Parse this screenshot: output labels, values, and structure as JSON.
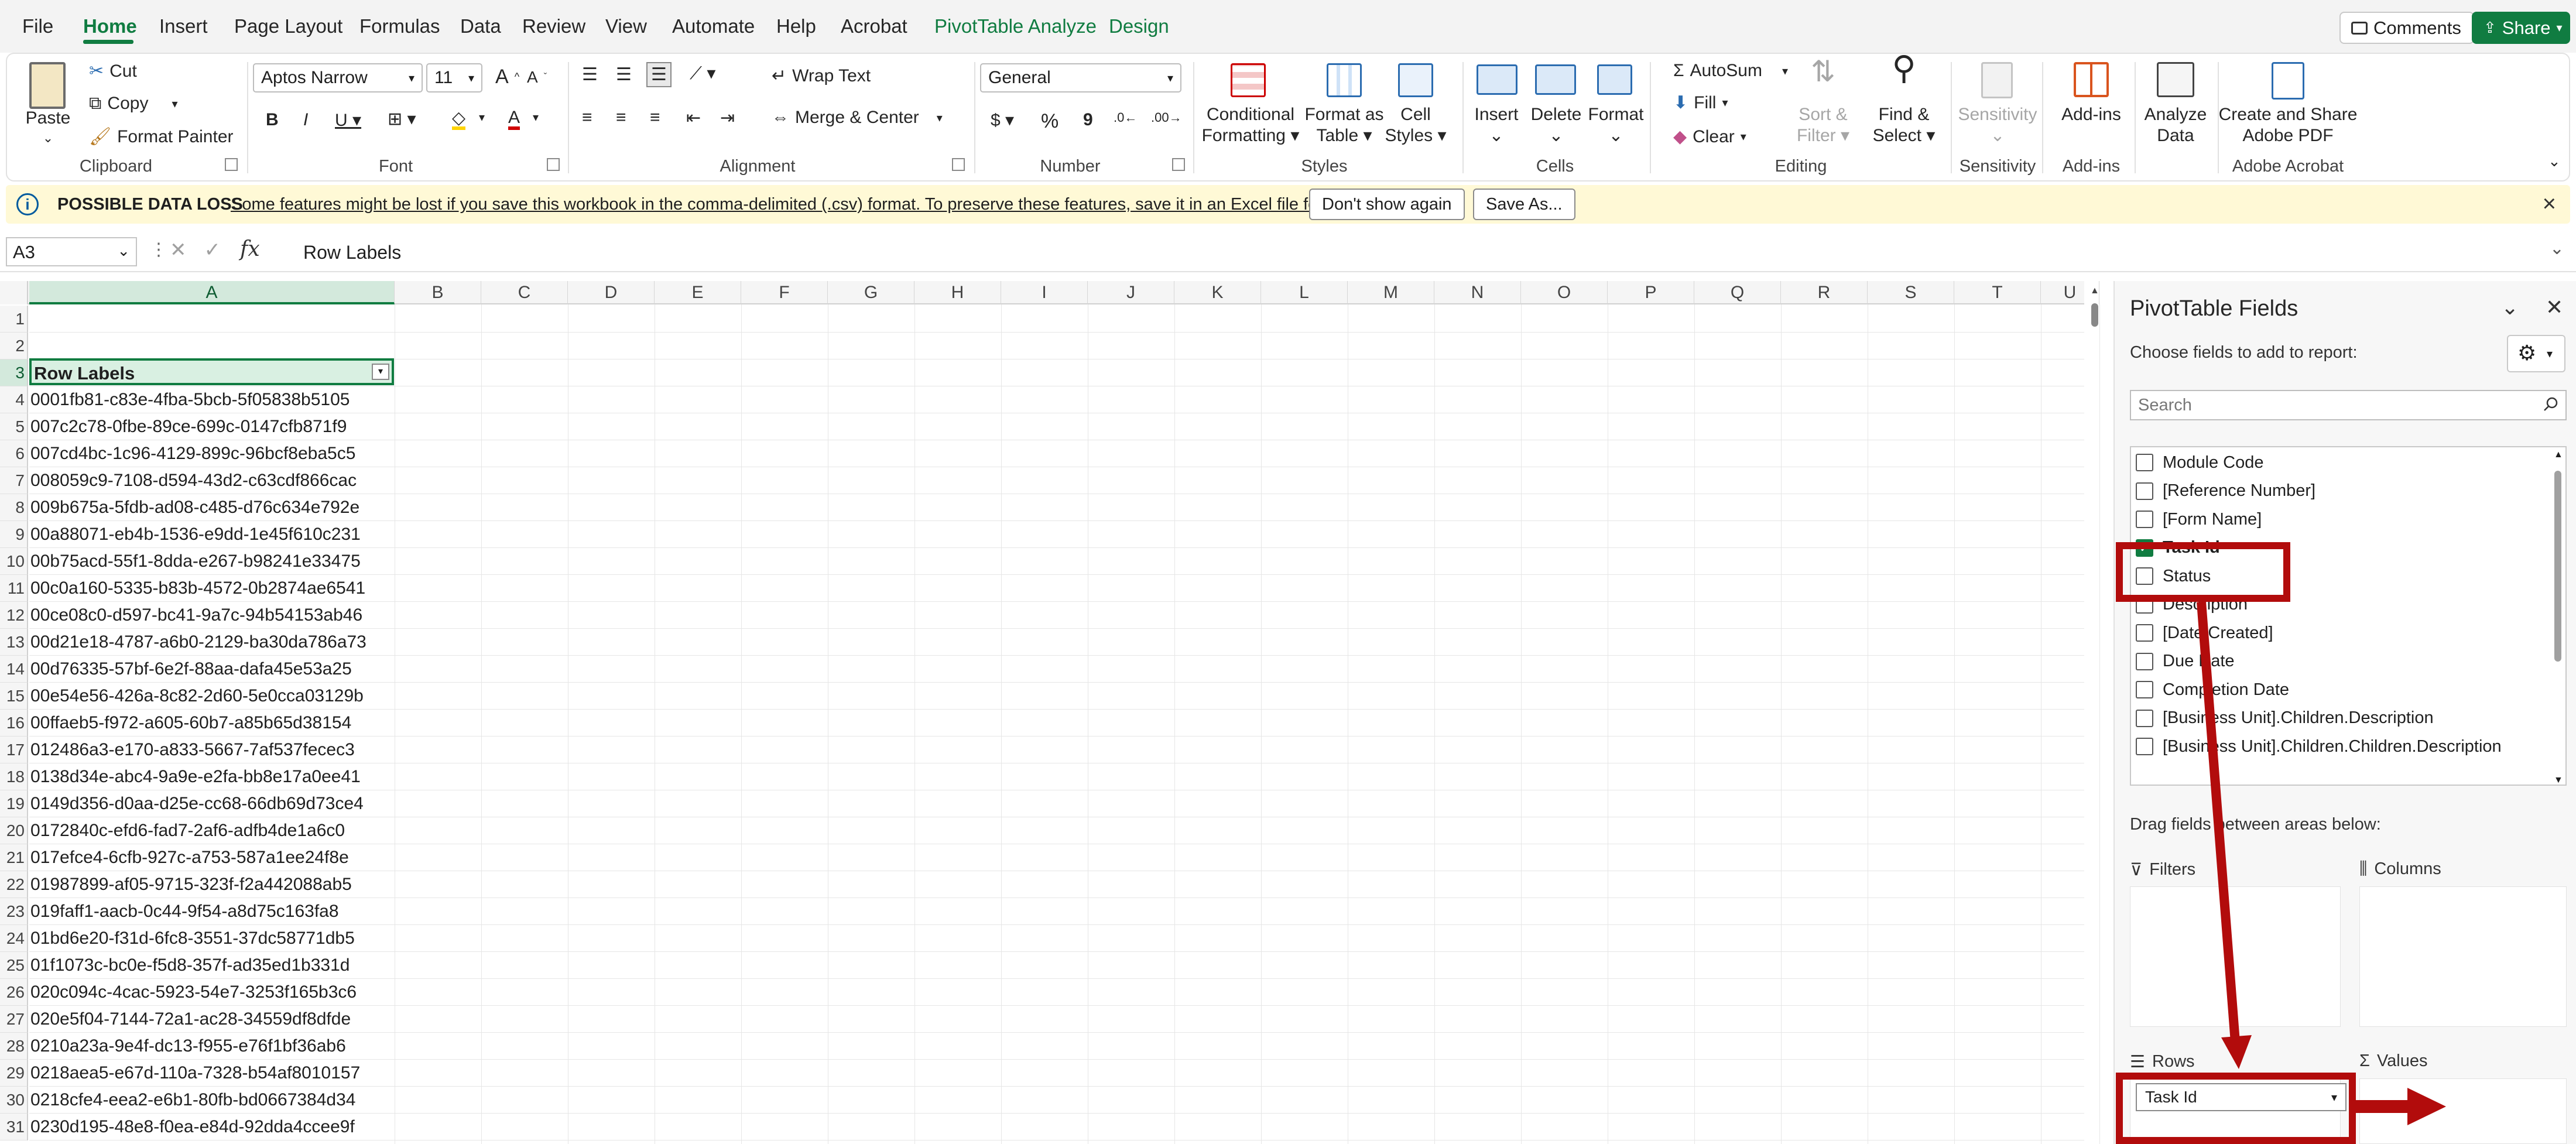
{
  "menu": {
    "tabs": [
      "File",
      "Home",
      "Insert",
      "Page Layout",
      "Formulas",
      "Data",
      "Review",
      "View",
      "Automate",
      "Help",
      "Acrobat",
      "PivotTable Analyze",
      "Design"
    ],
    "comments_label": "Comments",
    "share_label": "Share"
  },
  "ribbon": {
    "clipboard": {
      "paste": "Paste",
      "cut": "Cut",
      "copy": "Copy",
      "format_painter": "Format Painter",
      "label": "Clipboard"
    },
    "font": {
      "name": "Aptos Narrow",
      "size": "11",
      "label": "Font"
    },
    "alignment": {
      "wrap_text": "Wrap Text",
      "merge_center": "Merge & Center",
      "label": "Alignment"
    },
    "number": {
      "format": "General",
      "label": "Number"
    },
    "styles": {
      "conditional_1": "Conditional",
      "conditional_2": "Formatting",
      "format_as_1": "Format as",
      "format_as_2": "Table",
      "cell_styles_1": "Cell",
      "cell_styles_2": "Styles",
      "label": "Styles"
    },
    "cells": {
      "insert": "Insert",
      "delete": "Delete",
      "format": "Format",
      "label": "Cells"
    },
    "editing": {
      "autosum": "AutoSum",
      "fill": "Fill",
      "clear": "Clear",
      "sort_1": "Sort &",
      "sort_2": "Filter",
      "find_1": "Find &",
      "find_2": "Select",
      "label": "Editing"
    },
    "sensitivity": {
      "button": "Sensitivity",
      "label": "Sensitivity"
    },
    "addins": {
      "button": "Add-ins",
      "label": "Add-ins"
    },
    "analyze": {
      "line1": "Analyze",
      "line2": "Data"
    },
    "acrobat": {
      "line1": "Create and Share",
      "line2": "Adobe PDF",
      "label": "Adobe Acrobat"
    }
  },
  "infobar": {
    "title": "POSSIBLE DATA LOSS",
    "message": "Some features might be lost if you save this workbook in the comma-delimited (.csv) format. To preserve these features, save it in an Excel file format.",
    "dont_show": "Don't show again",
    "save_as": "Save As..."
  },
  "formula_bar": {
    "name_box": "A3",
    "fx": "fx",
    "content": "Row Labels"
  },
  "sheet": {
    "columns": [
      "A",
      "B",
      "C",
      "D",
      "E",
      "F",
      "G",
      "H",
      "I",
      "J",
      "K",
      "L",
      "M",
      "N",
      "O",
      "P",
      "Q",
      "R",
      "S",
      "T",
      "U"
    ],
    "row_numbers": [
      "1",
      "2",
      "3",
      "4",
      "5",
      "6",
      "7",
      "8",
      "9",
      "10",
      "11",
      "12",
      "13",
      "14",
      "15",
      "16",
      "17",
      "18",
      "19",
      "20",
      "21",
      "22",
      "23",
      "24",
      "25",
      "26",
      "27",
      "28",
      "29",
      "30",
      "31"
    ],
    "header_cell": "Row Labels",
    "values": [
      "0001fb81-c83e-4fba-5bcb-5f05838b5105",
      "007c2c78-0fbe-89ce-699c-0147cfb871f9",
      "007cd4bc-1c96-4129-899c-96bcf8eba5c5",
      "008059c9-7108-d594-43d2-c63cdf866cac",
      "009b675a-5fdb-ad08-c485-d76c634e792e",
      "00a88071-eb4b-1536-e9dd-1e45f610c231",
      "00b75acd-55f1-8dda-e267-b98241e33475",
      "00c0a160-5335-b83b-4572-0b2874ae6541",
      "00ce08c0-d597-bc41-9a7c-94b54153ab46",
      "00d21e18-4787-a6b0-2129-ba30da786a73",
      "00d76335-57bf-6e2f-88aa-dafa45e53a25",
      "00e54e56-426a-8c82-2d60-5e0cca03129b",
      "00ffaeb5-f972-a605-60b7-a85b65d38154",
      "012486a3-e170-a833-5667-7af537fecec3",
      "0138d34e-abc4-9a9e-e2fa-bb8e17a0ee41",
      "0149d356-d0aa-d25e-cc68-66db69d73ce4",
      "0172840c-efd6-fad7-2af6-adfb4de1a6c0",
      "017efce4-6cfb-927c-a753-587a1ee24f8e",
      "01987899-af05-9715-323f-f2a442088ab5",
      "019faff1-aacb-0c44-9f54-a8d75c163fa8",
      "01bd6e20-f31d-6fc8-3551-37dc58771db5",
      "01f1073c-bc0e-f5d8-357f-ad35ed1b331d",
      "020c094c-4cac-5923-54e7-3253f165b3c6",
      "020e5f04-7144-72a1-ac28-34559df8dfde",
      "0210a23a-9e4f-dc13-f955-e76f1bf36ab6",
      "0218aea5-e67d-110a-7328-b54af8010157",
      "0218cfe4-eea2-e6b1-80fb-bd0667384d34",
      "0230d195-48e8-f0ea-e84d-92dda4ccee9f"
    ]
  },
  "pivot_pane": {
    "title": "PivotTable Fields",
    "subtitle": "Choose fields to add to report:",
    "search_placeholder": "Search",
    "fields": [
      {
        "label": "Module Code",
        "checked": false
      },
      {
        "label": "[Reference Number]",
        "checked": false
      },
      {
        "label": "[Form Name]",
        "checked": false
      },
      {
        "label": "Task Id",
        "checked": true
      },
      {
        "label": "Status",
        "checked": false
      },
      {
        "label": "Description",
        "checked": false
      },
      {
        "label": "[Date Created]",
        "checked": false
      },
      {
        "label": "Due Date",
        "checked": false
      },
      {
        "label": "Completion Date",
        "checked": false
      },
      {
        "label": "[Business Unit].Children.Description",
        "checked": false
      },
      {
        "label": "[Business Unit].Children.Children.Description",
        "checked": false
      }
    ],
    "drag_label": "Drag fields between areas below:",
    "areas": {
      "filters": "Filters",
      "columns": "Columns",
      "rows": "Rows",
      "values": "Values"
    },
    "rows_field": "Task Id"
  },
  "colors": {
    "accent": "#107c41",
    "annotation": "#b20c0c",
    "infobar": "#fff9d6"
  }
}
